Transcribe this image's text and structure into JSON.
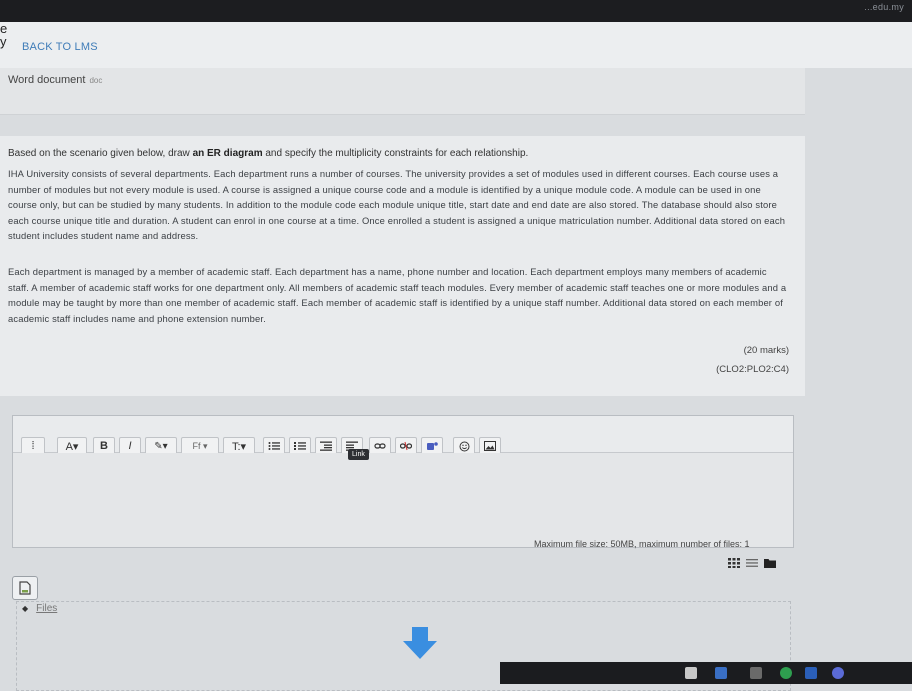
{
  "browser": {
    "url_fragment": "...edu.my"
  },
  "nav": {
    "back_label": "BACK TO LMS"
  },
  "document": {
    "title": "Word document",
    "ext": "doc"
  },
  "question": {
    "intro_before": "Based on the scenario given below, draw ",
    "intro_bold": "an ER diagram",
    "intro_after": " and specify the multiplicity constraints for each relationship.",
    "para1": "IHA University consists of several departments. Each department runs a number of courses. The university provides a set of modules used in different courses. Each course uses a number of modules but not every module is used. A course is assigned a unique course code and a module is identified by a unique module code. A module can be used in one course only, but can be studied by many students. In addition to the module code each module unique title, start date and end date are also stored. The database should also store each course unique title and duration. A student can enrol in one course at a time. Once enrolled a student is assigned a unique matriculation number. Additional data stored on each student includes student name and address.",
    "para2": "Each department is managed by a member of academic staff. Each department has a name, phone number and location. Each department employs many members of academic staff. A member of academic staff works for one department only. All members of academic staff teach modules. Every member of academic staff teaches one or more modules and a module may be taught by more than one member of academic staff. Each member of academic staff is identified by a unique staff number. Additional data stored on each member of academic staff includes name and phone extension number.",
    "marks": "(20 marks)",
    "clo": "(CLO2:PLO2:C4)"
  },
  "editor": {
    "toolbar": {
      "collapse": "⁞",
      "font_color": "A▾",
      "bold": "B",
      "italic": "I",
      "brush": "✎▾",
      "font": "Ff ▾",
      "size": "T:▾"
    },
    "tooltip": "Link"
  },
  "filepicker": {
    "limits": "Maximum file size: 50MB, maximum number of files: 1",
    "files_label": "Files"
  },
  "colors": {
    "link": "#3f7cb8",
    "drop_arrow": "#3a8ee0"
  }
}
